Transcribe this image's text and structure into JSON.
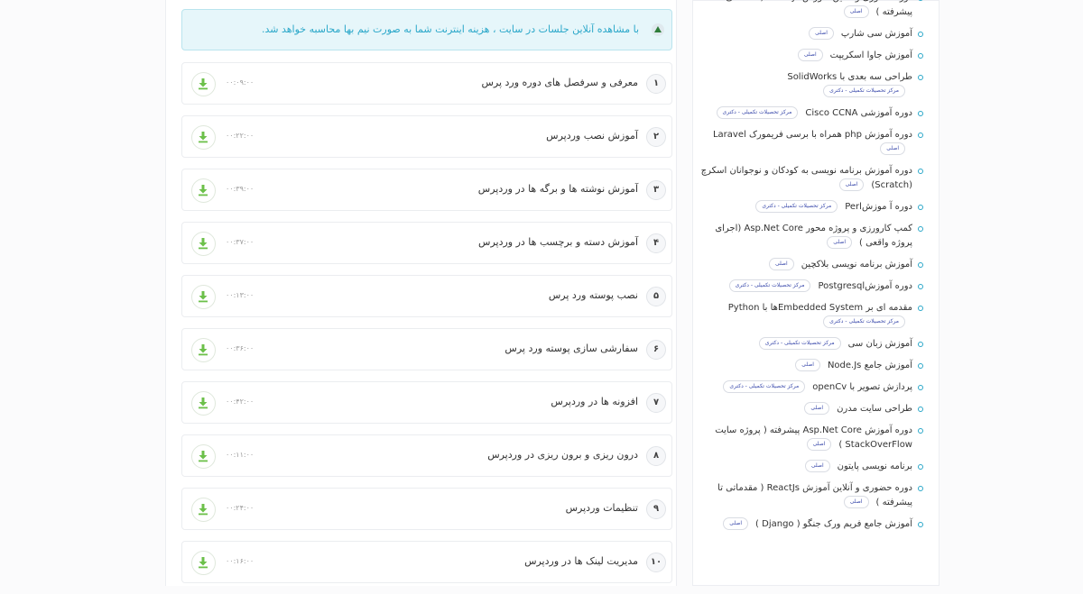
{
  "notice": {
    "text": "با مشاهده آنلاین جلسات در سایت ، هزینه اینترنت شما به صورت نیم بها محاسبه خواهد شد."
  },
  "sessions": [
    {
      "num": "۱",
      "title": "معرفی و سرفصل های دوره ورد پرس",
      "duration": "۰۰:۰۹:۰۰"
    },
    {
      "num": "۲",
      "title": "آموزش نصب وردپرس",
      "duration": "۰۰:۲۲:۰۰"
    },
    {
      "num": "۳",
      "title": "آموزش نوشته ها و برگه ها در وردپرس",
      "duration": "۰۰:۳۹:۰۰"
    },
    {
      "num": "۴",
      "title": "آموزش دسته و برچسب ها در وردپرس",
      "duration": "۰۰:۳۷:۰۰"
    },
    {
      "num": "۵",
      "title": "نصب پوسته ورد پرس",
      "duration": "۰۰:۱۳:۰۰"
    },
    {
      "num": "۶",
      "title": "سفارشی سازی پوسته ورد پرس",
      "duration": "۰۰:۳۶:۰۰"
    },
    {
      "num": "۷",
      "title": "افزونه ها در وردپرس",
      "duration": "۰۰:۴۲:۰۰"
    },
    {
      "num": "۸",
      "title": "درون ریزی و برون ریزی در وردپرس",
      "duration": "۰۰:۱۱:۰۰"
    },
    {
      "num": "۹",
      "title": "تنظیمات وردپرس",
      "duration": "۰۰:۲۴:۰۰"
    },
    {
      "num": "۱۰",
      "title": "مدیریت لینک ها در وردپرس",
      "duration": "۰۰:۱۶:۰۰"
    }
  ],
  "courses": [
    {
      "title": "دوره حضوری و آنلاین آموزش ReactJs ( مقدماتی تا پیشرفته )",
      "badge": "اصلی"
    },
    {
      "title": "آموزش سی شارپ",
      "badge": "اصلی"
    },
    {
      "title": "آموزش جاوا اسکریپت",
      "badge": "اصلی"
    },
    {
      "title": "طراحی سه بعدی با SolidWorks",
      "badge": "مرکز تحصیلات تکمیلی - دکتری"
    },
    {
      "title": "دوره آموزشی Cisco CCNA",
      "badge": "مرکز تحصیلات تکمیلی - دکتری"
    },
    {
      "title": "دوره آموزش php همراه با برسی فریمورک Laravel",
      "badge": "اصلی"
    },
    {
      "title": "دوره آموزش برنامه نویسی به کودکان و نوجوانان اسکرچ (Scratch)",
      "badge": "اصلی"
    },
    {
      "title": "دوره آ موزشPerl",
      "badge": "مرکز تحصیلات تکمیلی - دکتری"
    },
    {
      "title": "کمپ کارورزی و پروژه محور Asp.Net Core (اجرای پروژه واقعی )",
      "badge": "اصلی"
    },
    {
      "title": "آموزش برنامه نویسی بلاکچین",
      "badge": "اصلی"
    },
    {
      "title": "دوره آموزشPostgresql",
      "badge": "مرکز تحصیلات تکمیلی - دکتری"
    },
    {
      "title": "مقدمه ای بر Embedded Systemها با Python",
      "badge": "مرکز تحصیلات تکمیلی - دکتری"
    },
    {
      "title": "آموزش زبان سی",
      "badge": "مرکز تحصیلات تکمیلی - دکتری"
    },
    {
      "title": "آموزش جامع Node.Js",
      "badge": "اصلی"
    },
    {
      "title": "پردازش تصویر با openCv",
      "badge": "مرکز تحصیلات تکمیلی - دکتری"
    },
    {
      "title": "طراحی سایت مدرن",
      "badge": "اصلی"
    },
    {
      "title": "دوره آموزش Asp.Net Core پیشرفته ( پروژه سایت StackOverFlow )",
      "badge": "اصلی"
    },
    {
      "title": "برنامه نویسی پایتون",
      "badge": "اصلی"
    },
    {
      "title": "دوره حضوری و آنلاین آموزش ReactJs ( مقدماتی تا پیشرفته )",
      "badge": "اصلی"
    },
    {
      "title": "آموزش جامع فریم ورک جنگو ( Django )",
      "badge": "اصلی"
    }
  ],
  "colors": {
    "accent": "#2aa7c9",
    "download": "#6cc04a",
    "badge_text": "#3949ab"
  }
}
